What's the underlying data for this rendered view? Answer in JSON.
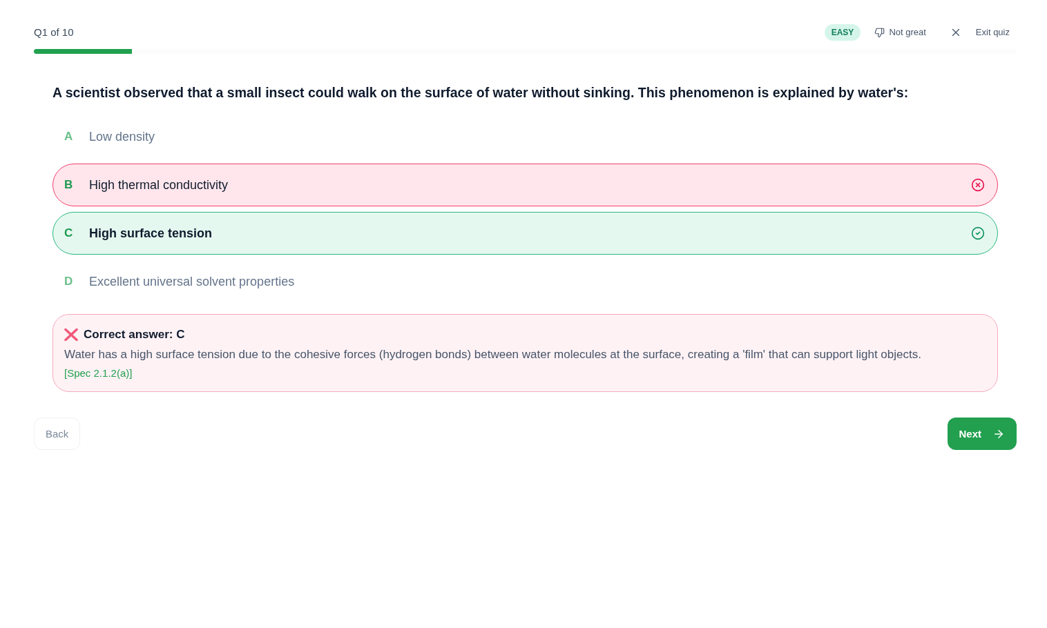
{
  "header": {
    "progress": {
      "label": "Q1 of 10",
      "level": 0.1
    },
    "difficulty": "EASY",
    "feedback_button": "Not great",
    "exit_button": "Exit quiz"
  },
  "question": "A scientist observed that a small insect could walk on the surface of water without sinking. This phenomenon is explained by water's:",
  "options": [
    {
      "letter": "A",
      "text": "Low density",
      "selected": false,
      "correct": false
    },
    {
      "letter": "B",
      "text": "High thermal conductivity",
      "selected": true,
      "correct": false
    },
    {
      "letter": "C",
      "text": "High surface tension",
      "selected": false,
      "correct": true
    },
    {
      "letter": "D",
      "text": "Excellent universal solvent properties",
      "selected": false,
      "correct": false
    }
  ],
  "feedback": {
    "correct": false,
    "title": "Correct answer: C",
    "explanation": "Water has a high surface tension due to the cohesive forces (hydrogen bonds) between water molecules at the surface, creating a 'film' that can support light objects.",
    "reference": "[Spec 2.1.2(a)]"
  },
  "navigation": {
    "back": "Back",
    "next": "Next"
  }
}
